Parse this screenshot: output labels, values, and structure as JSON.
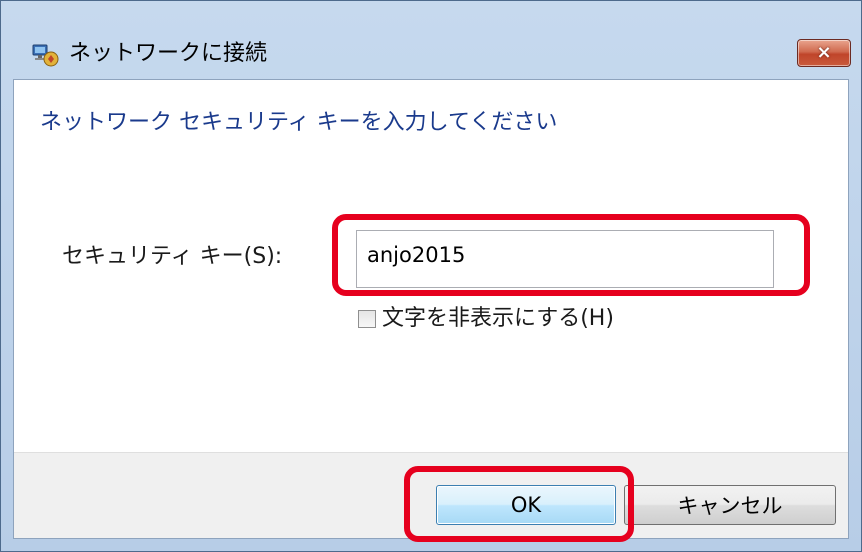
{
  "window": {
    "title": "ネットワークに接続",
    "close_label": "×"
  },
  "dialog": {
    "heading": "ネットワーク セキュリティ キーを入力してください",
    "security_key_label": "セキュリティ キー(S):",
    "security_key_value": "anjo2015",
    "hide_characters_label": "文字を非表示にする(H)",
    "hide_characters_checked": false
  },
  "buttons": {
    "ok_label": "OK",
    "cancel_label": "キャンセル"
  },
  "annotations": {
    "highlight_color": "#e6001e"
  },
  "icons": {
    "title_icon": "network-connect-icon",
    "close_icon": "close-icon",
    "checkbox": "checkbox"
  }
}
